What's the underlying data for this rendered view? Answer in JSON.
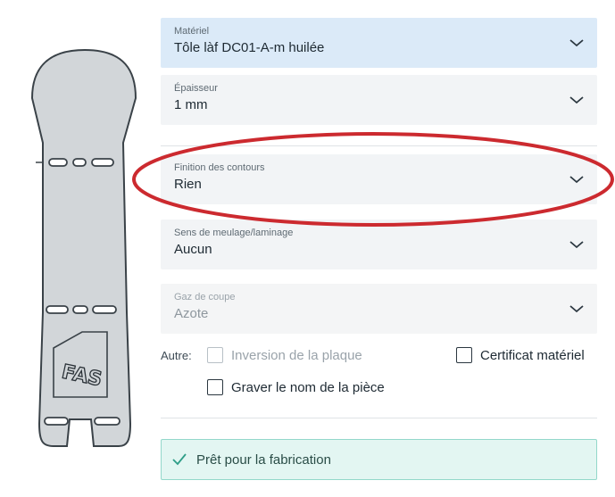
{
  "fields": [
    {
      "label": "Matériel",
      "value": "Tôle làf DC01-A-m huilée"
    },
    {
      "label": "Épaisseur",
      "value": "1 mm"
    },
    {
      "label": "Finition des contours",
      "value": "Rien"
    },
    {
      "label": "Sens de meulage/laminage",
      "value": "Aucun"
    },
    {
      "label": "Gaz de coupe",
      "value": "Azote",
      "disabled": true
    }
  ],
  "options": {
    "label": "Autre:",
    "items": [
      {
        "label": "Inversion de la plaque",
        "checked": false,
        "disabled": true
      },
      {
        "label": "Certificat matériel",
        "checked": false,
        "disabled": false
      },
      {
        "label": "Graver le nom de la pièce",
        "checked": false,
        "disabled": false
      }
    ]
  },
  "status": {
    "text": "Prêt pour la fabrication",
    "icon": "check-icon",
    "color": "#e3f6f2"
  },
  "preview": {
    "engraving": "FAS"
  },
  "annotation": {
    "shape": "ellipse",
    "color": "#cc2a2f",
    "target": "Finition des contours"
  }
}
